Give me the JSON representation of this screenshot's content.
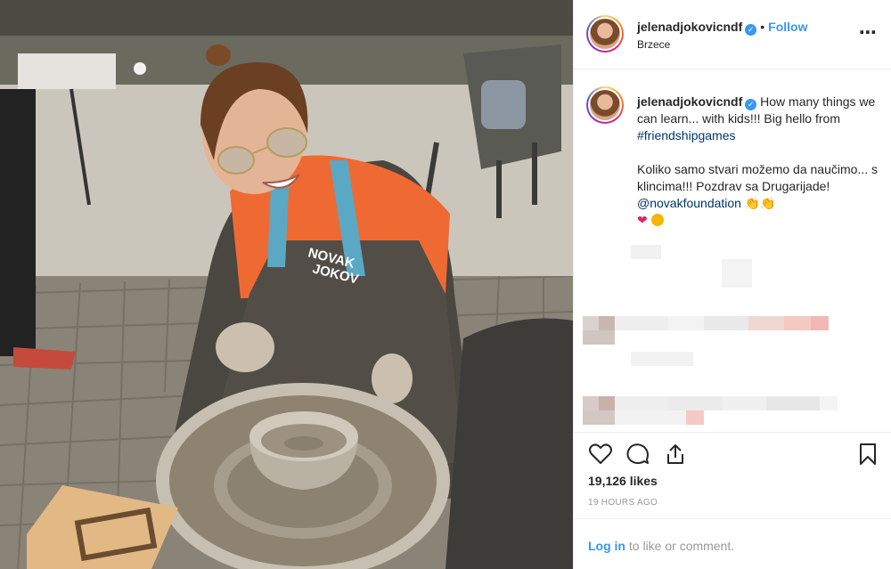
{
  "post": {
    "username": "jelenadjokovicndf",
    "follow_label": "Follow",
    "separator": "•",
    "location": "Brzece",
    "more_icon": "⋯",
    "verified_icon": "✓"
  },
  "caption": {
    "username": "jelenadjokovicndf",
    "line1_text": "How many things we can learn... with kids!!! Big hello from ",
    "line1_hashtag": "#friendshipgames",
    "line2_text": "Koliko samo stvari možemo da naučimo... s klincima!!! Pozdrav sa Drugarijade! ",
    "line2_mention": "@novakfoundation",
    "emoji_clap": "👏👏",
    "emoji_heart": "❤"
  },
  "engagement": {
    "likes": "19,126 likes",
    "timestamp": "19 HOURS AGO",
    "login_link": "Log in",
    "login_suffix": " to like or comment."
  },
  "photo": {
    "shirt_text_line1": "NOVAK",
    "shirt_text_line2": "JOKOV"
  },
  "colors": {
    "accent": "#3897f0",
    "link": "#003569",
    "muted": "#999999",
    "border": "#efefef",
    "shirt": "#ef6a32"
  }
}
